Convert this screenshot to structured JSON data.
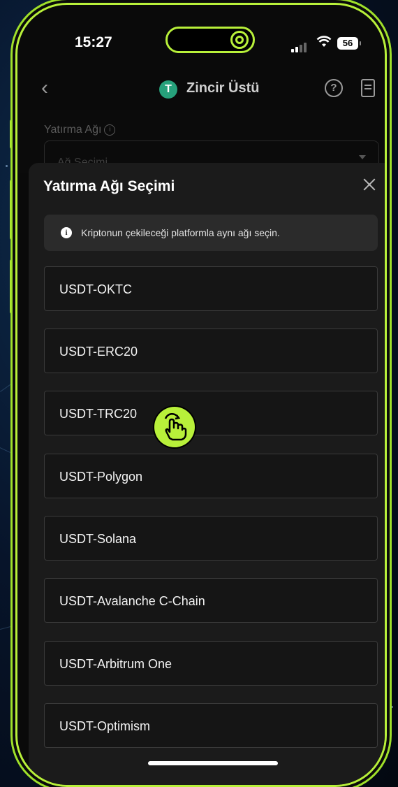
{
  "status_bar": {
    "time": "15:27",
    "battery": "56",
    "icons": [
      "signal-icon",
      "wifi-icon",
      "battery-icon"
    ]
  },
  "header": {
    "title": "Zincir Üstü",
    "coin_symbol": "T",
    "icons": [
      "back-chevron-icon",
      "tether-icon",
      "help-icon",
      "clipboard-icon"
    ]
  },
  "background_form": {
    "label": "Yatırma Ağı",
    "select_value": "Ağ Seçimi"
  },
  "sheet": {
    "title": "Yatırma Ağı Seçimi",
    "notice": "Kriptonun çekileceği platformla aynı ağı seçin.",
    "options": [
      {
        "label": "USDT-OKTC"
      },
      {
        "label": "USDT-ERC20"
      },
      {
        "label": "USDT-TRC20"
      },
      {
        "label": "USDT-Polygon"
      },
      {
        "label": "USDT-Solana"
      },
      {
        "label": "USDT-Avalanche C-Chain"
      },
      {
        "label": "USDT-Arbitrum One"
      },
      {
        "label": "USDT-Optimism"
      }
    ]
  },
  "colors": {
    "accent": "#b8f03a",
    "sheet_bg": "#1b1b1b",
    "option_border": "#3a3a3a",
    "tether": "#26a17b"
  }
}
